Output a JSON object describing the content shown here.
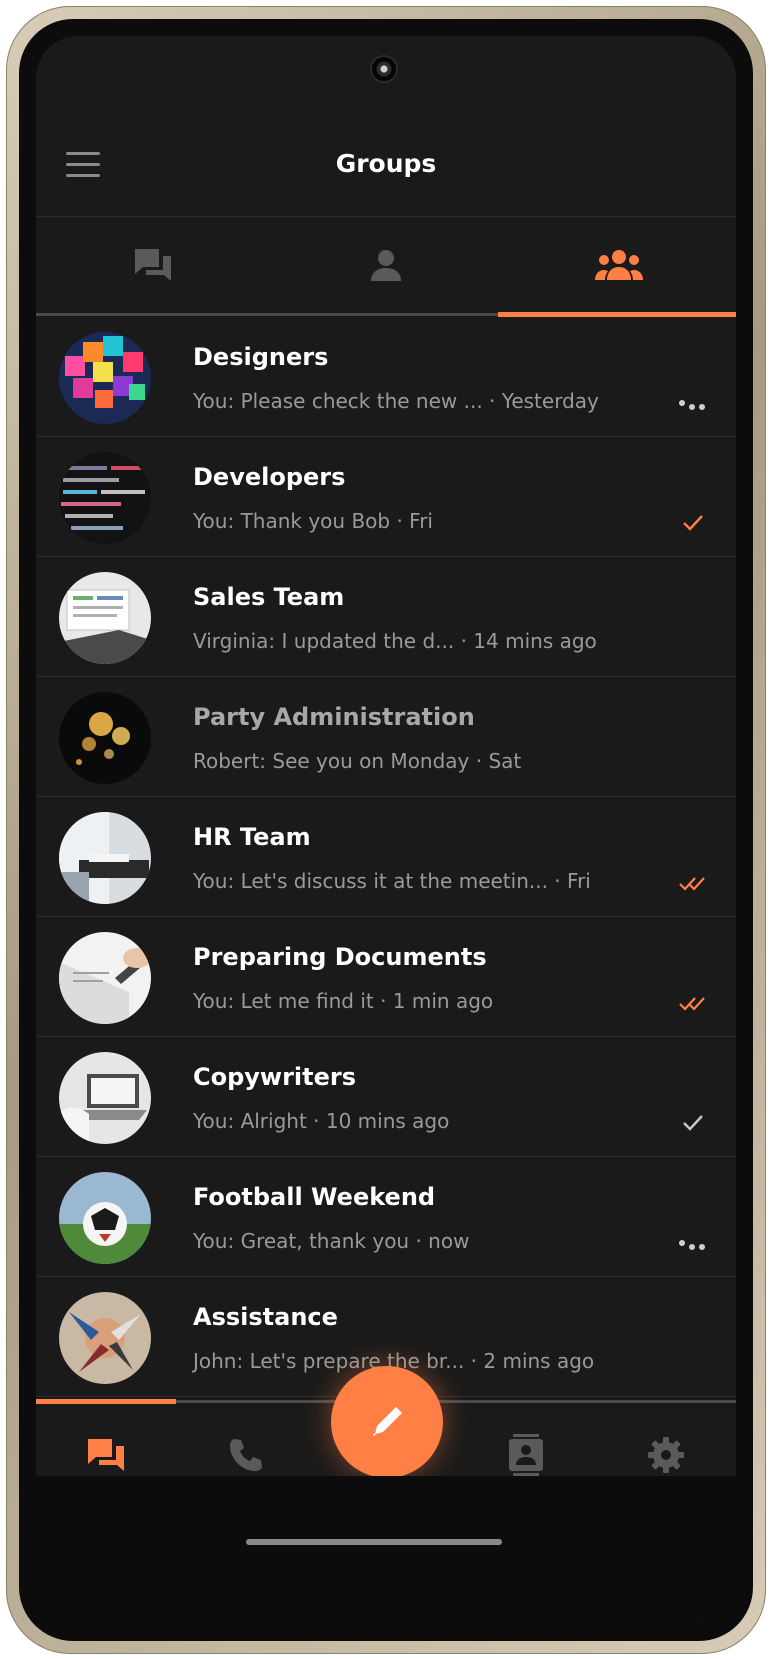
{
  "header": {
    "title": "Groups"
  },
  "top_tabs": [
    {
      "icon": "chat-bubbles-icon",
      "active": false
    },
    {
      "icon": "person-icon",
      "active": false
    },
    {
      "icon": "group-icon",
      "active": true
    }
  ],
  "groups": [
    {
      "name": "Designers",
      "preview": "You: Please check the new ... · Yesterday",
      "status": "typing"
    },
    {
      "name": "Developers",
      "preview": "You: Thank you Bob · Fri",
      "status": "sent-orange"
    },
    {
      "name": "Sales Team",
      "preview": "Virginia: I updated the d... · 14 mins ago",
      "status": "none"
    },
    {
      "name": "Party Administration",
      "preview": "Robert: See you on Monday · Sat",
      "status": "none"
    },
    {
      "name": "HR Team",
      "preview": "You: Let's discuss it at the meetin... · Fri",
      "status": "read"
    },
    {
      "name": "Preparing Documents",
      "preview": "You: Let me find it · 1 min ago",
      "status": "read"
    },
    {
      "name": "Copywriters",
      "preview": "You: Alright · 10 mins ago",
      "status": "sent-gray"
    },
    {
      "name": "Football Weekend",
      "preview": "You: Great, thank you · now",
      "status": "typing"
    },
    {
      "name": "Assistance",
      "preview": "John: Let's prepare the br... · 2 mins ago",
      "status": "none"
    }
  ],
  "bottom_nav": [
    {
      "icon": "chats-icon",
      "active": true
    },
    {
      "icon": "phone-icon",
      "active": false
    },
    {
      "icon": "compose-icon",
      "active": false
    },
    {
      "icon": "contacts-icon",
      "active": false
    },
    {
      "icon": "gear-icon",
      "active": false
    }
  ],
  "colors": {
    "accent": "#ff7f45",
    "background": "#1a1a1a",
    "muted": "#9a9a9a"
  }
}
